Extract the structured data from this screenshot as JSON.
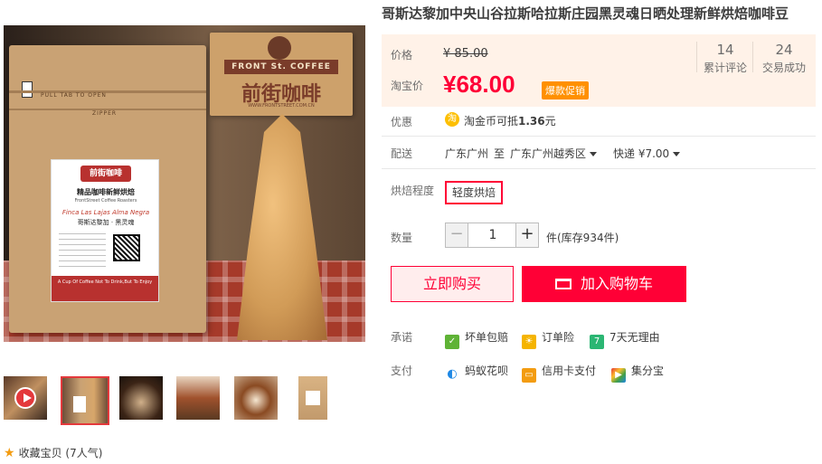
{
  "product": {
    "title": "哥斯达黎加中央山谷拉斯哈拉斯庄园黑灵魂日晒处理新鲜烘焙咖啡豆"
  },
  "image_text": {
    "bag_zip1": "PULL TAB TO OPEN",
    "bag_zip2": "ZIPPER",
    "label_logo": "前街咖啡",
    "label_title": "精品咖啡新鲜烘焙",
    "label_sub": "FrontStreet Coffee Roasters",
    "label_name": "Finca Las Lajas Alma Negra",
    "label_name_cn": "哥斯达黎加 · 黑灵魂",
    "label_foot": "A Cup Of Coffee Not To Drink,But To Enjoy",
    "sign_en": "FRONT St. COFFEE",
    "sign_cn": "前街咖啡",
    "sign_url": "WWW.FRONTSTREET.COM.CN"
  },
  "price": {
    "label": "价格",
    "original": "¥ 85.00",
    "promo_label": "淘宝价",
    "current": "¥68.00",
    "badge": "爆款促销"
  },
  "stats": [
    {
      "number": "14",
      "label": "累计评论"
    },
    {
      "number": "24",
      "label": "交易成功"
    }
  ],
  "discount": {
    "label": "优惠",
    "coin_icon": "淘",
    "text_prefix": "淘金币可抵",
    "amount": "1.36",
    "text_suffix": "元"
  },
  "shipping": {
    "label": "配送",
    "from": "广东广州",
    "to_word": "至",
    "to": "广东广州越秀区",
    "method": "快递 ¥7.00"
  },
  "option": {
    "label": "烘焙程度",
    "value": "轻度烘焙"
  },
  "quantity": {
    "label": "数量",
    "minus": "−",
    "value": "1",
    "plus": "+",
    "stock": "件(库存934件)"
  },
  "actions": {
    "buy_now": "立即购买",
    "add_cart": "加入购物车"
  },
  "promise": {
    "label": "承诺",
    "items": [
      "坏单包赔",
      "订单险",
      "7天无理由"
    ]
  },
  "payment": {
    "label": "支付",
    "items": [
      "蚂蚁花呗",
      "信用卡支付",
      "集分宝"
    ]
  },
  "favorite": {
    "text": "收藏宝贝",
    "count": "(7人气)"
  },
  "colors": {
    "accent": "#ff0036",
    "price_bg": "#fff2e8",
    "badge": "#ff9000"
  }
}
